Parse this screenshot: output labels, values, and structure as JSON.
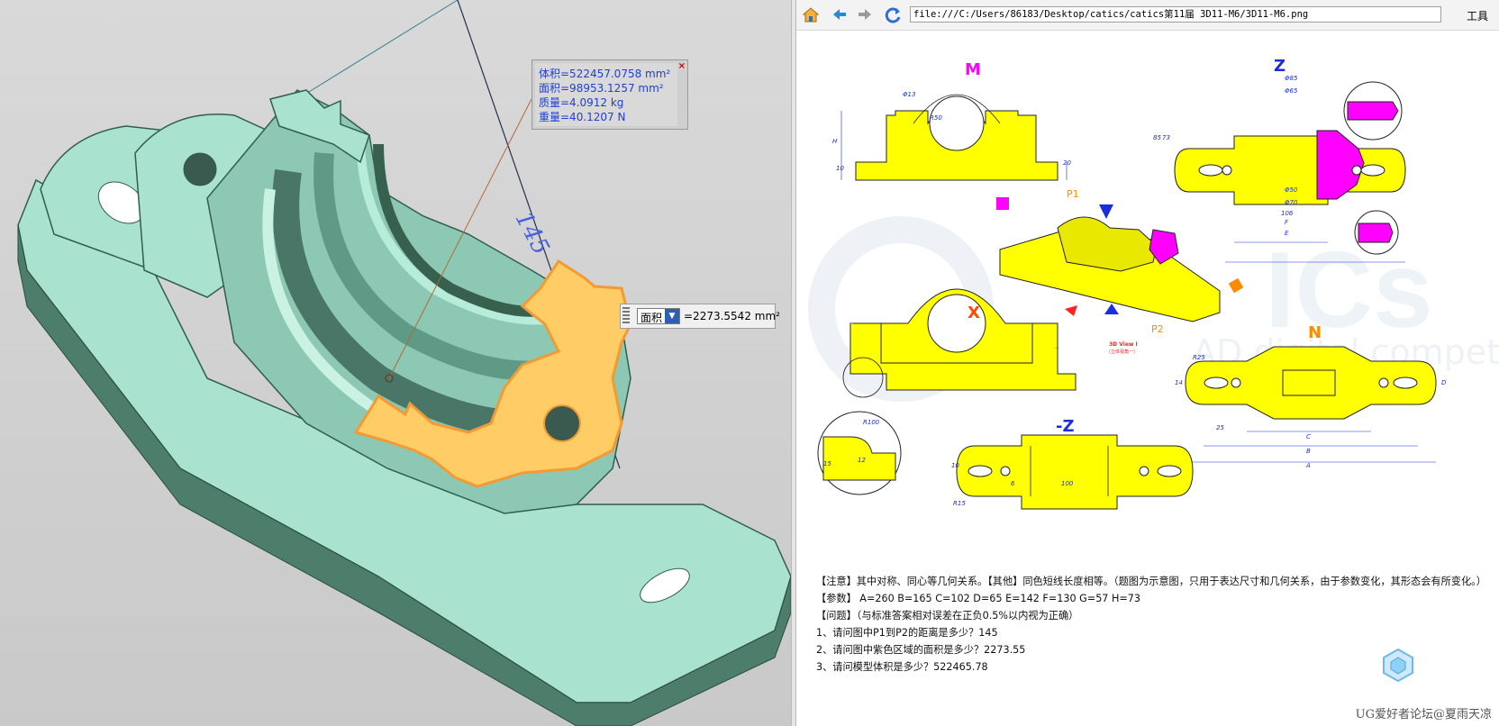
{
  "cad": {
    "measurements": [
      "体积=522457.0758 mm²",
      "面积=98953.1257 mm²",
      "质量=4.0912 kg",
      "重量=40.1207 N"
    ],
    "close_symbol": "×",
    "dimension_label": "145",
    "area_widget": {
      "mode": "面积",
      "value": "=2273.5542 mm²"
    },
    "colors": {
      "part": "#a9e2cf",
      "part_dark": "#4d7e6c",
      "selected_face": "#ffcc66",
      "selected_edge": "#f29a33"
    }
  },
  "viewer": {
    "address": "file:///C:/Users/86183/Desktop/catics/catics第11届 3D11-M6/3D11-M6.png",
    "tools_label": "工具",
    "icons": [
      "home-icon",
      "back-icon",
      "forward-icon",
      "refresh-icon"
    ],
    "views": {
      "m": "M",
      "z": "Z",
      "x": "X",
      "n": "N",
      "neg_z": "-Z",
      "p1": "P1",
      "p2": "P2",
      "view_caption": "3D View I",
      "view_sub": "(立体视角一)"
    },
    "dims": {
      "z_d85": "Φ85",
      "z_d65": "Φ65",
      "z_d50": "Φ50",
      "z_d70": "Φ70",
      "z_106": "106",
      "z_f": "F",
      "z_e": "E",
      "z_85": "85",
      "z_73": "73",
      "m_d13": "Φ13",
      "m_r50": "R50",
      "m_20": "20",
      "m_10": "10",
      "m_h": "H",
      "n_25": "25",
      "n_c": "C",
      "n_b": "B",
      "n_a": "A",
      "n_d": "D",
      "n_14": "14",
      "n_r25": "R25",
      "nz_100": "100",
      "nz_6": "6",
      "nz_10": "10",
      "nz_r15": "R15",
      "det_r100": "R100",
      "det_15": "15",
      "det_12": "12"
    },
    "bg_watermark": "AD digital competition",
    "notes": [
      "【注意】其中对称、同心等几何关系。【其他】同色短线长度相等。（题图为示意图，只用于表达尺寸和几何关系，由于参数变化，其形态会有所变化。）",
      "【参数】 A=260   B=165   C=102   D=65   E=142   F=130   G=57   H=73",
      "【问题】（与标准答案相对误差在正负0.5%以内视为正确）",
      "1、请问图中P1到P2的距离是多少？145",
      "2、请问图中紫色区域的面积是多少？2273.55",
      "3、请问模型体积是多少？522465.78"
    ],
    "credit": "UG爱好者论坛@夏雨天凉",
    "colors": {
      "yellow": "#ffff00",
      "magenta": "#ff00ff",
      "orange": "#ff8a00",
      "blue": "#1a2ee0",
      "red": "#ff2222"
    }
  }
}
